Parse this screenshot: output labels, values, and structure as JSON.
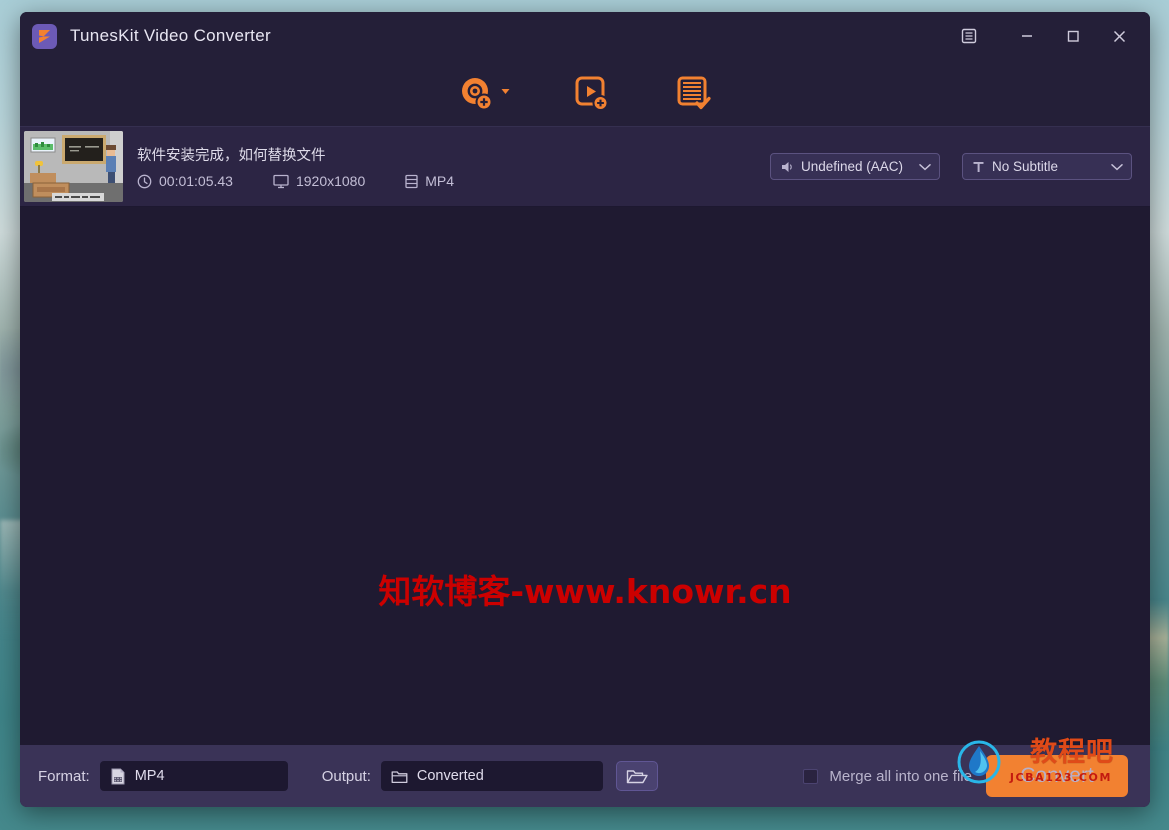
{
  "window": {
    "title": "TunesKit Video Converter",
    "logo_icon": "tuneskit-play-logo",
    "controls": [
      {
        "name": "menu-button",
        "icon": "menu-icon"
      },
      {
        "name": "minimize-button",
        "icon": "minimize-icon"
      },
      {
        "name": "maximize-button",
        "icon": "maximize-icon"
      },
      {
        "name": "close-button",
        "icon": "close-icon"
      }
    ]
  },
  "toolbar": {
    "items": [
      {
        "name": "add-dvd-button",
        "icon": "disc-add-icon",
        "has_caret": true
      },
      {
        "name": "add-video-button",
        "icon": "video-add-icon",
        "has_caret": false
      },
      {
        "name": "conversion-list-button",
        "icon": "list-check-icon",
        "has_caret": false
      }
    ]
  },
  "file_list": {
    "rows": [
      {
        "thumbnail": "classroom-video-thumbnail",
        "name": "软件安装完成，如何替换文件",
        "duration": "00:01:05.43",
        "resolution": "1920x1080",
        "format": "MP4",
        "audio_track": "Undefined (AAC)",
        "subtitle_track": "No Subtitle",
        "duration_icon": "clock-icon",
        "resolution_icon": "monitor-icon",
        "format_icon": "film-icon",
        "audio_icon": "speaker-icon",
        "subtitle_icon": "text-t-icon"
      }
    ]
  },
  "content": {
    "watermark": "知软博客-www.knowr.cn"
  },
  "bottom_bar": {
    "format_label": "Format:",
    "format_value": "MP4",
    "format_icon": "video-file-icon",
    "output_label": "Output:",
    "output_value": "Converted",
    "output_icon": "folder-icon",
    "browse_icon": "open-folder-icon",
    "merge_label": "Merge all into one file",
    "merge_checked": false,
    "convert_label": "Convert"
  },
  "overlay_watermark": {
    "brand_cn": "教程吧",
    "url": "JCBA123.COM",
    "logo_icon": "water-drop-logo"
  },
  "colors": {
    "window_bg": "#241f38",
    "file_row_bg": "#2c2544",
    "content_bg": "#1f1a31",
    "bottom_bar_bg": "#3a3357",
    "accent_orange": "#f28131",
    "watermark_red": "#cc0000"
  }
}
